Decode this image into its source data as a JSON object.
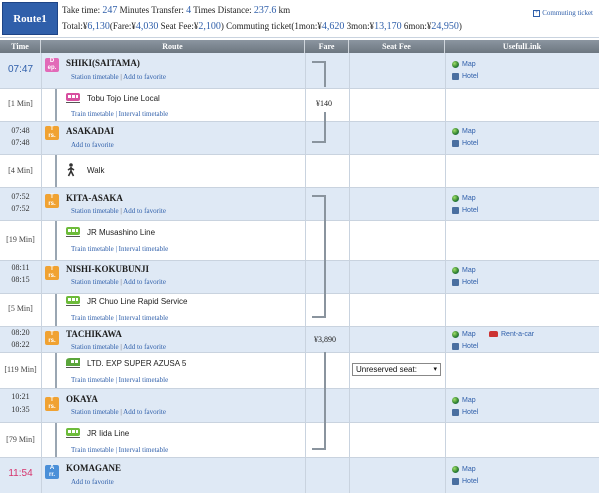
{
  "header": {
    "route_label": "Route1",
    "take_time_label": "Take time:",
    "take_time_value": "247",
    "take_time_unit": "Minutes",
    "transfer_label": "Transfer:",
    "transfer_value": "4",
    "transfer_unit": "Times",
    "distance_label": "Distance:",
    "distance_value": "237.6",
    "distance_unit": "km",
    "total_label": "Total:¥",
    "total_value": "6,130",
    "fare_label": "(Fare:¥",
    "fare_value": "4,030",
    "seat_fee_label": "Seat Fee:¥",
    "seat_fee_value": "2,100",
    "seat_fee_close": ")",
    "commute_label": "Commuting ticket(1mon:¥",
    "commute_1mon": "4,620",
    "commute_3mon_label": "3mon:¥",
    "commute_3mon": "13,170",
    "commute_6mon_label": "6mon:¥",
    "commute_6mon": "24,950",
    "commute_close": ")",
    "commute_link": "Commuting ticket"
  },
  "columns": {
    "time": "Time",
    "route": "Route",
    "fare": "Fare",
    "seat_fee": "Seat Fee",
    "useful": "UsefulLink"
  },
  "links": {
    "station_timetable": "Station timetable",
    "add_favorite": "Add to favorite",
    "train_timetable": "Train timetable",
    "interval_timetable": "Interval timetable",
    "separator": "|",
    "map": "Map",
    "hotel": "Hotel",
    "rent_a_car": "Rent-a-car"
  },
  "icons": {
    "dep_line1": "D",
    "dep_line2": "ep.",
    "tr_line1": "T",
    "tr_line2": "rs.",
    "arr_line1": "A",
    "arr_line2": "rr."
  },
  "stations": [
    {
      "name": "SHIKI(SAITAMA)",
      "time": "07:47"
    },
    {
      "name": "ASAKADAI",
      "arr": "07:48",
      "dep": "07:48"
    },
    {
      "name": "KITA-ASAKA",
      "arr": "07:52",
      "dep": "07:52"
    },
    {
      "name": "NISHI-KOKUBUNJI",
      "arr": "08:11",
      "dep": "08:15"
    },
    {
      "name": "TACHIKAWA",
      "arr": "08:20",
      "dep": "08:22"
    },
    {
      "name": "OKAYA",
      "arr": "10:21",
      "dep": "10:35"
    },
    {
      "name": "KOMAGANE",
      "time": "11:54"
    }
  ],
  "legs": [
    {
      "duration": "[1 Min]",
      "name": "Tobu Tojo Line Local",
      "fare": "¥140"
    },
    {
      "duration": "[4 Min]",
      "name": "Walk"
    },
    {
      "duration": "[19 Min]",
      "name": "JR Musashino Line"
    },
    {
      "duration": "[5 Min]",
      "name": "JR Chuo Line Rapid Service"
    },
    {
      "duration": "[119 Min]",
      "name": "LTD. EXP SUPER AZUSA 5",
      "seat": "Unreserved seat:"
    },
    {
      "duration": "[79 Min]",
      "name": "JR Iida Line"
    }
  ],
  "fare_total_2": "¥3,890",
  "colors": {
    "accent": "#2f5faa",
    "dep_icon": "#e26ab8",
    "transfer_icon": "#f0a232",
    "arrival_icon": "#4a8fd8",
    "station_row": "#dfe9f5",
    "header_row": "#7a848e"
  }
}
